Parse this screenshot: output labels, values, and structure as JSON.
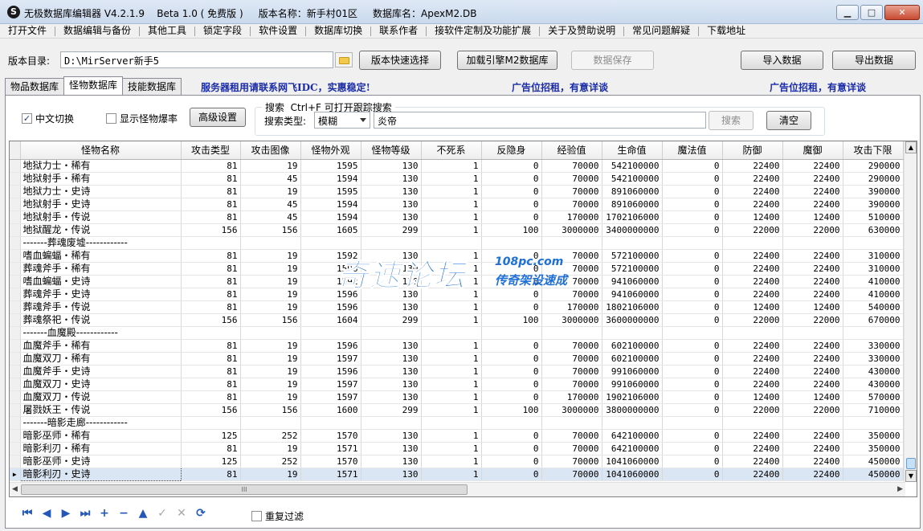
{
  "window": {
    "title": "无极数据库编辑器 V4.2.1.9    Beta 1.0 ( 免费版 )     版本名称：新手村01区     数据库名：ApexM2.DB",
    "icon_char": "S"
  },
  "menu": [
    "打开文件",
    "数据编辑与备份",
    "其他工具",
    "锁定字段",
    "软件设置",
    "数据库切换",
    "联系作者",
    "接软件定制及功能扩展",
    "关于及赞助说明",
    "常见问题解疑",
    "下载地址"
  ],
  "toolbar": {
    "dir_label": "版本目录:",
    "dir_value": "D:\\MirServer新手5",
    "quick_select": "版本快速选择",
    "load_engine": "加载引擎M2数据库",
    "save_data": "数据保存",
    "import_data": "导入数据",
    "export_data": "导出数据"
  },
  "tabs": [
    "物品数据库",
    "怪物数据库",
    "技能数据库"
  ],
  "ads": [
    "服务器租用请联系网飞IDC，实惠稳定!",
    "广告位招租，有意详谈",
    "广告位招租，有意详谈"
  ],
  "filters": {
    "chinese_switch": "中文切换",
    "show_drop": "显示怪物爆率",
    "advanced": "高级设置",
    "search_legend": "搜索  Ctrl+F 可打开跟踪搜索",
    "search_type_label": "搜索类型:",
    "search_type_value": "模糊",
    "search_value": "炎帝",
    "search_btn": "搜索",
    "clear_btn": "清空",
    "dup_filter": "重复过滤"
  },
  "grid": {
    "columns": [
      "怪物名称",
      "攻击类型",
      "攻击图像",
      "怪物外观",
      "怪物等级",
      "不死系",
      "反隐身",
      "经验值",
      "生命值",
      "魔法值",
      "防御",
      "魔御",
      "攻击下限"
    ],
    "rows": [
      [
        "地狱力士・稀有",
        "81",
        "19",
        "1595",
        "130",
        "1",
        "0",
        "70000",
        "542100000",
        "0",
        "22400",
        "22400",
        "290000"
      ],
      [
        "地狱射手・稀有",
        "81",
        "45",
        "1594",
        "130",
        "1",
        "0",
        "70000",
        "542100000",
        "0",
        "22400",
        "22400",
        "290000"
      ],
      [
        "地狱力士・史诗",
        "81",
        "19",
        "1595",
        "130",
        "1",
        "0",
        "70000",
        "891060000",
        "0",
        "22400",
        "22400",
        "390000"
      ],
      [
        "地狱射手・史诗",
        "81",
        "45",
        "1594",
        "130",
        "1",
        "0",
        "70000",
        "891060000",
        "0",
        "22400",
        "22400",
        "390000"
      ],
      [
        "地狱射手・传说",
        "81",
        "45",
        "1594",
        "130",
        "1",
        "0",
        "170000",
        "1702106000",
        "0",
        "12400",
        "12400",
        "510000"
      ],
      [
        "地狱醒龙・传说",
        "156",
        "156",
        "1605",
        "299",
        "1",
        "100",
        "3000000",
        "3400000000",
        "0",
        "22000",
        "22000",
        "630000"
      ],
      [
        "-------葬魂废墟------------",
        "",
        "",
        "",
        "",
        "",
        "",
        "",
        "",
        "",
        "",
        "",
        ""
      ],
      [
        "嗜血蝙蝠・稀有",
        "81",
        "19",
        "1592",
        "130",
        "1",
        "0",
        "70000",
        "572100000",
        "0",
        "22400",
        "22400",
        "310000"
      ],
      [
        "葬魂斧手・稀有",
        "81",
        "19",
        "1596",
        "130",
        "1",
        "0",
        "70000",
        "572100000",
        "0",
        "22400",
        "22400",
        "310000"
      ],
      [
        "嗜血蝙蝠・史诗",
        "81",
        "19",
        "1592",
        "130",
        "1",
        "0",
        "70000",
        "941060000",
        "0",
        "22400",
        "22400",
        "410000"
      ],
      [
        "葬魂斧手・史诗",
        "81",
        "19",
        "1596",
        "130",
        "1",
        "0",
        "70000",
        "941060000",
        "0",
        "22400",
        "22400",
        "410000"
      ],
      [
        "葬魂斧手・传说",
        "81",
        "19",
        "1596",
        "130",
        "1",
        "0",
        "170000",
        "1802106000",
        "0",
        "12400",
        "12400",
        "540000"
      ],
      [
        "葬魂祭祀・传说",
        "156",
        "156",
        "1604",
        "299",
        "1",
        "100",
        "3000000",
        "3600000000",
        "0",
        "22000",
        "22000",
        "670000"
      ],
      [
        "-------血魔殿------------",
        "",
        "",
        "",
        "",
        "",
        "",
        "",
        "",
        "",
        "",
        "",
        ""
      ],
      [
        "血魔斧手・稀有",
        "81",
        "19",
        "1596",
        "130",
        "1",
        "0",
        "70000",
        "602100000",
        "0",
        "22400",
        "22400",
        "330000"
      ],
      [
        "血魔双刀・稀有",
        "81",
        "19",
        "1597",
        "130",
        "1",
        "0",
        "70000",
        "602100000",
        "0",
        "22400",
        "22400",
        "330000"
      ],
      [
        "血魔斧手・史诗",
        "81",
        "19",
        "1596",
        "130",
        "1",
        "0",
        "70000",
        "991060000",
        "0",
        "22400",
        "22400",
        "430000"
      ],
      [
        "血魔双刀・史诗",
        "81",
        "19",
        "1597",
        "130",
        "1",
        "0",
        "70000",
        "991060000",
        "0",
        "22400",
        "22400",
        "430000"
      ],
      [
        "血魔双刀・传说",
        "81",
        "19",
        "1597",
        "130",
        "1",
        "0",
        "170000",
        "1902106000",
        "0",
        "12400",
        "12400",
        "570000"
      ],
      [
        "屠戮妖王・传说",
        "156",
        "156",
        "1600",
        "299",
        "1",
        "100",
        "3000000",
        "3800000000",
        "0",
        "22000",
        "22000",
        "710000"
      ],
      [
        "-------暗影走廊------------",
        "",
        "",
        "",
        "",
        "",
        "",
        "",
        "",
        "",
        "",
        "",
        ""
      ],
      [
        "暗影巫师・稀有",
        "125",
        "252",
        "1570",
        "130",
        "1",
        "0",
        "70000",
        "642100000",
        "0",
        "22400",
        "22400",
        "350000"
      ],
      [
        "暗影利刃・稀有",
        "81",
        "19",
        "1571",
        "130",
        "1",
        "0",
        "70000",
        "642100000",
        "0",
        "22400",
        "22400",
        "350000"
      ],
      [
        "暗影巫师・史诗",
        "125",
        "252",
        "1570",
        "130",
        "1",
        "0",
        "70000",
        "1041060000",
        "0",
        "22400",
        "22400",
        "450000"
      ],
      [
        "暗影利刃・史诗",
        "81",
        "19",
        "1571",
        "130",
        "1",
        "0",
        "70000",
        "1041060000",
        "0",
        "22400",
        "22400",
        "450000"
      ]
    ],
    "selected_row": 24,
    "hscroll_grip": "III"
  },
  "watermark": {
    "main": "奇速论坛",
    "domain": "108pc.com",
    "tag": "传奇架设速成"
  }
}
